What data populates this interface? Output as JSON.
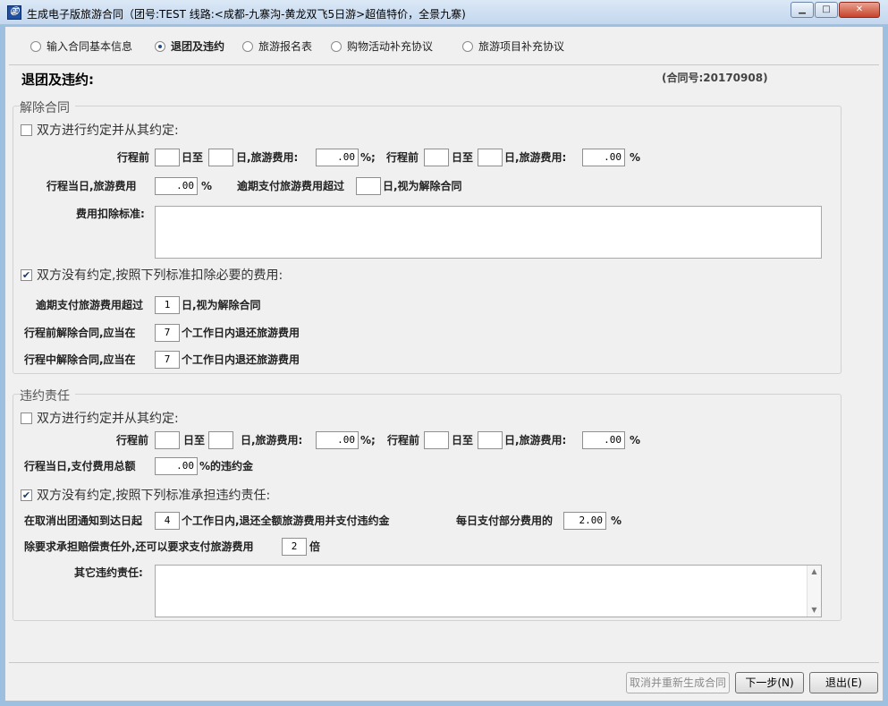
{
  "window": {
    "title": "生成电子版旅游合同（团号:TEST  线路:<成都-九寨沟-黄龙双飞5日游>超值特价，全景九寨)",
    "icon_text": "㊣",
    "minimize": "▁",
    "maximize": "□",
    "close": "✕"
  },
  "tabs": [
    {
      "label": "输入合同基本信息",
      "selected": false
    },
    {
      "label": "退团及违约",
      "selected": true
    },
    {
      "label": "旅游报名表",
      "selected": false
    },
    {
      "label": "购物活动补充协议",
      "selected": false
    },
    {
      "label": "旅游项目补充协议",
      "selected": false
    }
  ],
  "page": {
    "heading": "退团及违约:",
    "contract_no": "(合同号:20170908)"
  },
  "terminate": {
    "group_title": "解除合同",
    "agreed": {
      "checked": false,
      "label": "双方进行约定并从其约定:",
      "trip_before": "行程前",
      "day_to": "日至",
      "day_fee_1": "日,旅游费用:",
      "fee_1": ".00",
      "pct_semi": "%;",
      "trip_before_2": "行程前",
      "day_to_2": "日至",
      "day_fee_2": "日,旅游费用:",
      "fee_2": ".00",
      "pct": "%",
      "sameday": "行程当日,旅游费用",
      "fee_3": ".00",
      "pct_3": "%",
      "overdue": "逾期支付旅游费用超过",
      "overdue_tail": "日,视为解除合同",
      "deduct_label": "费用扣除标准:"
    },
    "not_agreed": {
      "checked": true,
      "check_mark": "✔",
      "label": "双方没有约定,按照下列标准扣除必要的费用:",
      "overdue": "逾期支付旅游费用超过",
      "overdue_days": "1",
      "overdue_tail": "日,视为解除合同",
      "before_trip": "行程前解除合同,应当在",
      "before_days": "7",
      "before_tail": "个工作日内退还旅游费用",
      "during_trip": "行程中解除合同,应当在",
      "during_days": "7",
      "during_tail": "个工作日内退还旅游费用"
    }
  },
  "liability": {
    "group_title": "违约责任",
    "agreed": {
      "checked": false,
      "label": "双方进行约定并从其约定:",
      "trip_before": "行程前",
      "day_to": "日至",
      "day_fee_1": "日,旅游费用:",
      "fee_1": ".00",
      "pct_semi": "%;",
      "trip_before_2": "行程前",
      "day_to_2": "日至",
      "day_fee_2": "日,旅游费用:",
      "fee_2": ".00",
      "pct": "%",
      "sameday": "行程当日,支付费用总额",
      "fee_3": ".00",
      "penalty": "%的违约金"
    },
    "not_agreed": {
      "checked": true,
      "check_mark": "✔",
      "label": "双方没有约定,按照下列标准承担违约责任:",
      "cancel_prefix": "在取消出团通知到达日起",
      "cancel_days": "4",
      "cancel_tail": "个工作日内,退还全额旅游费用并支付违约金",
      "daily_label": "每日支付部分费用的",
      "daily_value": "2.00",
      "daily_pct": "%",
      "compensation": "除要求承担赔偿责任外,还可以要求支付旅游费用",
      "multiplier": "2",
      "times": "倍",
      "other_label": "其它违约责任:",
      "scroll_up": "▲",
      "scroll_down": "▼"
    }
  },
  "footer": {
    "cancel_regen": "取消并重新生成合同",
    "next": "下一步(N)",
    "exit": "退出(E)"
  }
}
